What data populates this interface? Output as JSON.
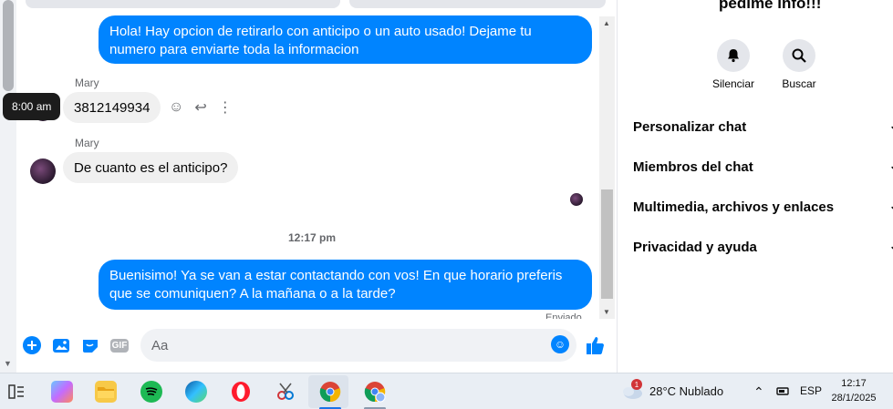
{
  "chat": {
    "messages": [
      {
        "type": "out",
        "text": "Hola! Hay opcion de retirarlo con anticipo o un auto usado! Dejame tu numero para enviarte toda la informacion"
      },
      {
        "type": "in",
        "sender": "Mary",
        "text": "3812149934"
      },
      {
        "type": "in",
        "sender": "Mary",
        "text": "De cuanto es el anticipo?"
      },
      {
        "type": "out",
        "text": "Buenisimo! Ya se van a estar contactando con vos! En que horario preferis que se comuniquen? A la mañana o a la tarde?"
      }
    ],
    "hover_time": "8:00 am",
    "timestamp": "12:17 pm",
    "sent_label": "Enviado"
  },
  "composer": {
    "placeholder": "Aa",
    "icons": [
      "plus-icon",
      "image-icon",
      "sticker-icon",
      "gif-icon",
      "emoji-icon",
      "like-icon"
    ],
    "gif_label": "GIF"
  },
  "info_panel": {
    "title": "pedime info!!!",
    "actions": [
      {
        "label": "Silenciar",
        "icon": "bell-icon"
      },
      {
        "label": "Buscar",
        "icon": "search-icon"
      }
    ],
    "sections": [
      {
        "label": "Personalizar chat"
      },
      {
        "label": "Miembros del chat"
      },
      {
        "label": "Multimedia, archivos y enlaces"
      },
      {
        "label": "Privacidad y ayuda"
      }
    ]
  },
  "taskbar": {
    "weather_badge": "1",
    "weather": "28°C  Nublado",
    "language": "ESP",
    "time": "12:17",
    "date": "28/1/2025"
  },
  "colors": {
    "accent": "#0084ff",
    "bubble_in": "#f0f0f0"
  }
}
